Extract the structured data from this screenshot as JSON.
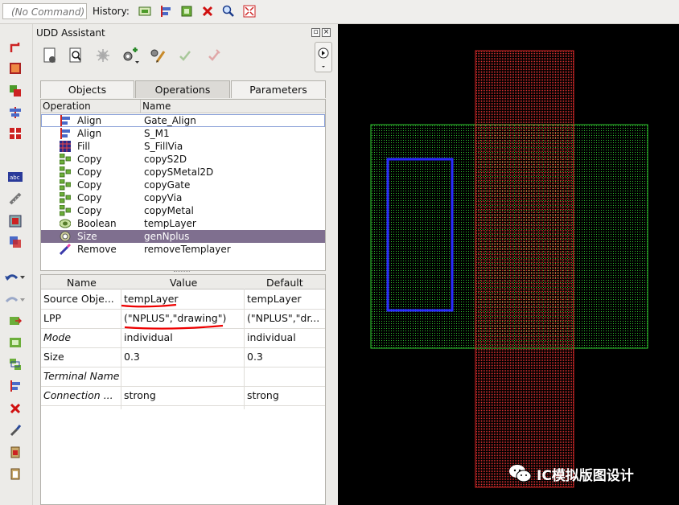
{
  "toolbar": {
    "command_placeholder": "(No Command)",
    "history_label": "History:",
    "icons": [
      "history-add-icon",
      "history-align-icon",
      "history-select-icon",
      "history-delete-icon",
      "history-zoom-icon",
      "history-fit-icon"
    ]
  },
  "left_tools": [
    "path-tool-icon",
    "rect-tool-icon",
    "copy-tool-icon",
    "align-tool-icon",
    "grid-tool-icon",
    "label-tool-icon",
    "ruler-tool-icon",
    "fill-tool-icon",
    "boolean-tool-icon",
    "undo-icon",
    "redo-icon",
    "move-in-icon",
    "copy-out-icon",
    "stack-icon",
    "align-vertical-icon",
    "delete-icon",
    "brush-icon",
    "paste-icon",
    "clipboard-icon"
  ],
  "panel": {
    "title": "UDD Assistant",
    "tabs": [
      {
        "label": "Objects"
      },
      {
        "label": "Operations"
      },
      {
        "label": "Parameters"
      }
    ],
    "active_tab": "Operations",
    "op_headers": {
      "operation": "Operation",
      "name": "Name"
    },
    "operations": [
      {
        "op": "Align",
        "name": "Gate_Align",
        "icon": "align-icon"
      },
      {
        "op": "Align",
        "name": "S_M1",
        "icon": "align-icon"
      },
      {
        "op": "Fill",
        "name": "S_FillVia",
        "icon": "fill-icon"
      },
      {
        "op": "Copy",
        "name": "copyS2D",
        "icon": "copy-icon"
      },
      {
        "op": "Copy",
        "name": "copySMetal2D",
        "icon": "copy-icon"
      },
      {
        "op": "Copy",
        "name": "copyGate",
        "icon": "copy-icon"
      },
      {
        "op": "Copy",
        "name": "copyVia",
        "icon": "copy-icon"
      },
      {
        "op": "Copy",
        "name": "copyMetal",
        "icon": "copy-icon"
      },
      {
        "op": "Boolean",
        "name": "tempLayer",
        "icon": "boolean-icon"
      },
      {
        "op": "Size",
        "name": "genNplus",
        "icon": "size-icon"
      },
      {
        "op": "Remove",
        "name": "removeTemplayer",
        "icon": "remove-icon"
      }
    ],
    "prop_headers": {
      "name": "Name",
      "value": "Value",
      "default": "Default"
    },
    "properties": [
      {
        "name": "Source Obje...",
        "value": "tempLayer",
        "default": "tempLayer",
        "italic": false
      },
      {
        "name": "LPP",
        "value": "(\"NPLUS\",\"drawing\")",
        "default": "(\"NPLUS\",\"dr...",
        "italic": false
      },
      {
        "name": "Mode",
        "value": "individual",
        "default": "individual",
        "italic": true
      },
      {
        "name": "Size",
        "value": "0.3",
        "default": "0.3",
        "italic": false
      },
      {
        "name": "Terminal Name",
        "value": "",
        "default": "",
        "italic": true
      },
      {
        "name": "Connection ...",
        "value": "strong",
        "default": "strong",
        "italic": true
      }
    ]
  },
  "canvas": {
    "background": "#000000",
    "layers": [
      "green-diffusion-shape",
      "blue-nplus-shape",
      "red-poly-shape"
    ]
  },
  "watermark": "IC模拟版图设计",
  "colors": {
    "selection": "#7f6f8f",
    "green": "#32d032",
    "red": "#e02828",
    "blue": "#2a2aff"
  }
}
